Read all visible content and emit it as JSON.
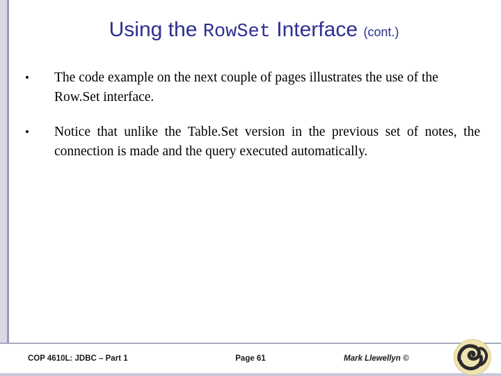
{
  "slide": {
    "title": {
      "part1": "Using the ",
      "mono": "RowSet",
      "part2": " Interface ",
      "cont": "(cont.)"
    },
    "bullets": [
      {
        "marker": "•",
        "text": "The code example on the next couple of pages illustrates the use of the Row.Set interface."
      },
      {
        "marker": "•",
        "text": "Notice that unlike the Table.Set version in the previous set of notes, the connection is made and the query executed automatically."
      }
    ],
    "footer": {
      "left": "COP 4610L: JDBC – Part 1",
      "center": "Page 61",
      "right": "Mark Llewellyn ©"
    },
    "colors": {
      "title": "#2e2e8f",
      "accent_bar": "#9a9ab4",
      "accent_bar_light": "#d9d9e6",
      "footer_rule": "#a6a6bd",
      "logo": "#efe3b0"
    }
  }
}
